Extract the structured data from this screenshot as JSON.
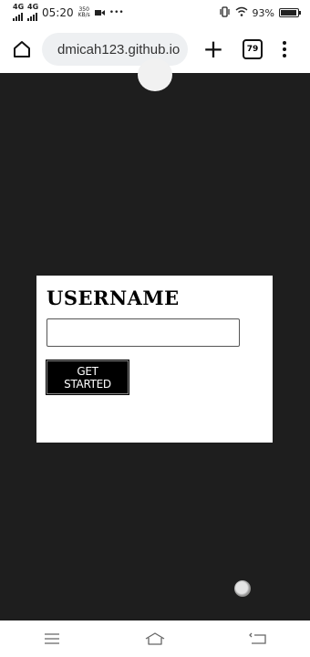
{
  "status_bar": {
    "sim1_label": "4G",
    "sim2_label": "4G",
    "time": "05:20",
    "net_speed_value": "350",
    "net_speed_unit": "KB/s",
    "more_indicator": "•••",
    "battery_percent": "93%",
    "battery_level": 0.93
  },
  "browser": {
    "url": "dmicah123.github.io",
    "new_tab_label": "+",
    "tab_count": "79"
  },
  "card": {
    "title": "USERNAME",
    "input_value": "",
    "button_label": "GET STARTED"
  },
  "colors": {
    "page_background": "#1e1e1e",
    "card_background": "#ffffff",
    "button_background": "#000000",
    "url_pill": "#eef0f2"
  },
  "icons": {
    "status": [
      "signal-icon",
      "video-icon",
      "vibrate-icon",
      "wifi-icon",
      "battery-icon"
    ],
    "browser": [
      "home-icon",
      "lock-icon",
      "plus-icon",
      "tabs-icon",
      "more-vert-icon"
    ],
    "nav": [
      "menu-lines-icon",
      "home-outline-icon",
      "back-icon"
    ]
  }
}
